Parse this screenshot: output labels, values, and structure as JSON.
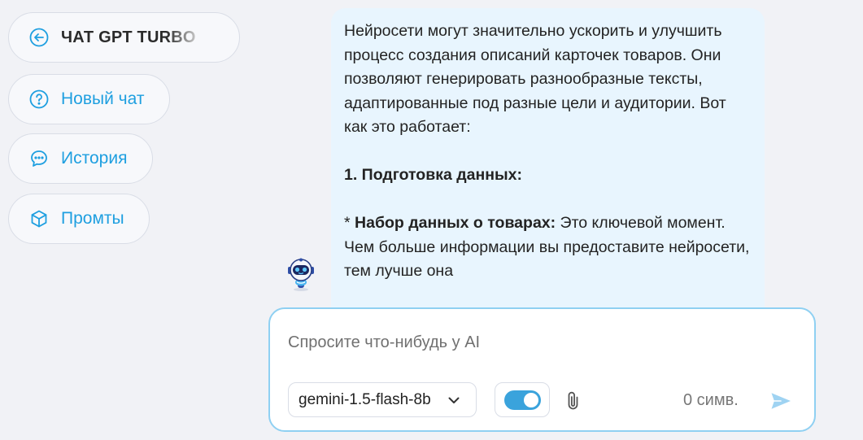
{
  "sidebar": {
    "brand": {
      "label": "ЧАТ GPT TURBO",
      "icon": "arrow-left-circle-icon"
    },
    "items": [
      {
        "label": "Новый чат",
        "icon": "question-circle-icon"
      },
      {
        "label": "История",
        "icon": "chat-bubble-icon"
      },
      {
        "label": "Промты",
        "icon": "cube-icon"
      }
    ]
  },
  "message": {
    "intro": "Нейросети могут значительно ускорить и улучшить процесс создания описаний карточек товаров. Они позволяют генерировать разнообразные тексты, адаптированные под разные цели и аудитории. Вот как это работает:",
    "heading": "1. Подготовка данных:",
    "bullet_marker": "* ",
    "bullet_bold": "Набор данных о товарах:",
    "bullet_text": " Это ключевой момент. Чем больше информации вы предоставите нейросети, тем лучше она"
  },
  "composer": {
    "placeholder": "Спросите что-нибудь у AI",
    "model": "gemini-1.5-flash-8b",
    "toggle_on": true,
    "char_count": "0 симв."
  },
  "colors": {
    "accent": "#1e9fe0",
    "bubble": "#e8f5fe",
    "background": "#f1f2f6",
    "composer_border": "#8fd0f2"
  }
}
